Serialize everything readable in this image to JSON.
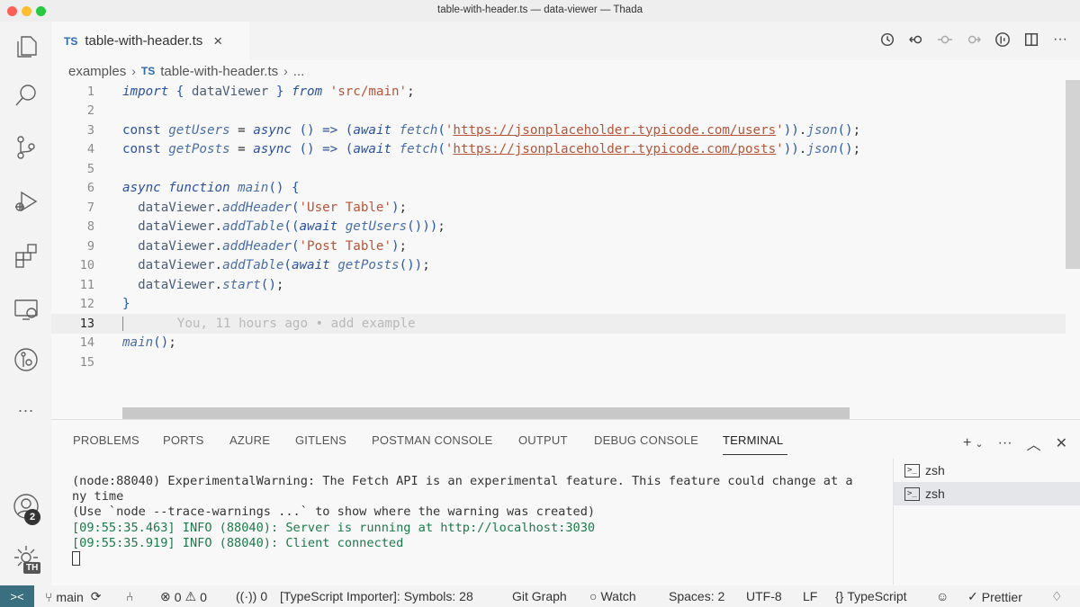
{
  "window": {
    "title": "table-with-header.ts — data-viewer — Thada"
  },
  "tab": {
    "lang": "TS",
    "name": "table-with-header.ts",
    "close": "×"
  },
  "breadcrumb": {
    "folder": "examples",
    "lang": "TS",
    "file": "table-with-header.ts",
    "more": "..."
  },
  "activity": {
    "icons": [
      "files-icon",
      "search-icon",
      "source-control-icon",
      "run-debug-icon",
      "extensions-icon",
      "remote-explorer-icon",
      "gitlens-icon",
      "more-icon"
    ],
    "accounts_badge": "2",
    "manage_badge": "TH"
  },
  "editor": {
    "line_numbers": [
      "1",
      "2",
      "3",
      "4",
      "5",
      "6",
      "7",
      "8",
      "9",
      "10",
      "11",
      "12",
      "13",
      "14",
      "15"
    ],
    "current_line": "13",
    "blame": "You, 11 hours ago • add example",
    "url_users": "https://jsonplaceholder.typicode.com/users",
    "url_posts": "https://jsonplaceholder.typicode.com/posts",
    "header_user": "'User Table'",
    "header_post": "'Post Table'",
    "import_path": "'src/main'"
  },
  "panel": {
    "tabs": [
      "PROBLEMS",
      "PORTS",
      "AZURE",
      "GITLENS",
      "POSTMAN CONSOLE",
      "OUTPUT",
      "DEBUG CONSOLE",
      "TERMINAL"
    ],
    "active_tab": "TERMINAL",
    "terminal_lines": [
      "(node:88040) ExperimentalWarning: The Fetch API is an experimental feature. This feature could change at a",
      "ny time",
      "(Use `node --trace-warnings ...` to show where the warning was created)",
      "[09:55:35.463] INFO (88040): Server is running at http://localhost:3030",
      "[09:55:35.919] INFO (88040): Client connected"
    ],
    "terminals": [
      "zsh",
      "zsh"
    ]
  },
  "status": {
    "branch": "main",
    "errors": "0",
    "warnings": "0",
    "ports": "0",
    "importer": "[TypeScript Importer]: Symbols: 28",
    "git_graph": "Git Graph",
    "watch": "Watch",
    "spaces": "Spaces: 2",
    "encoding": "UTF-8",
    "eol": "LF",
    "language": "TypeScript",
    "prettier": "Prettier"
  },
  "colors": {
    "remote_bg": "#3a6f7f",
    "keyword": "#2a51a0",
    "string": "#b5563a",
    "terminal_green": "#1c7a4a"
  }
}
